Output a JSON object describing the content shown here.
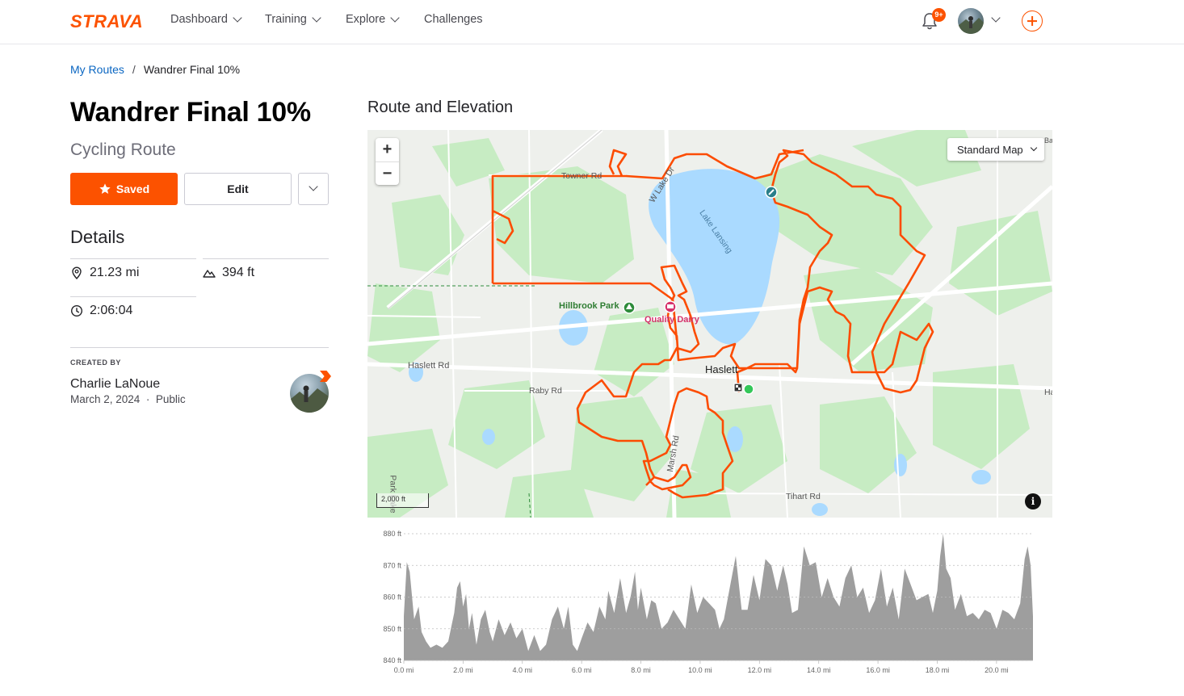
{
  "nav": {
    "logo": "STRAVA",
    "links": [
      "Dashboard",
      "Training",
      "Explore",
      "Challenges"
    ],
    "notification_badge": "9+",
    "accent": "#fc5200"
  },
  "breadcrumb": {
    "parent": "My Routes",
    "separator": "/",
    "current": "Wandrer Final 10%"
  },
  "route": {
    "title": "Wandrer Final 10%",
    "type": "Cycling Route",
    "saved_label": "Saved",
    "edit_label": "Edit"
  },
  "details": {
    "heading": "Details",
    "distance": "21.23 mi",
    "elevation": "394 ft",
    "time": "2:06:04"
  },
  "creator": {
    "label": "CREATED BY",
    "name": "Charlie LaNoue",
    "date": "March 2, 2024",
    "visibility": "Public"
  },
  "map": {
    "heading": "Route and Elevation",
    "style": "Standard Map",
    "zoom_in": "+",
    "zoom_out": "−",
    "scale": "2,000 ft",
    "info": "i",
    "labels": {
      "towner": "Towner Rd",
      "wlake": "W Lake Dr",
      "lake": "Lake Lansing",
      "hillbrook": "Hillbrook Park",
      "dairy": "Quality Dairy",
      "haslett_rd": "Haslett Rd",
      "haslett": "Haslett",
      "raby": "Raby Rd",
      "marsh": "Marsh Rd",
      "tihart": "Tihart Rd",
      "park": "Park Lake",
      "ha": "Ha",
      "ba": "Ba"
    },
    "colors": {
      "route": "#fc4c02",
      "water": "#aadaff",
      "park": "#c7ecc3"
    }
  },
  "chart_data": {
    "type": "area",
    "xlabel": "",
    "ylabel": "",
    "xlim": [
      0,
      21.23
    ],
    "ylim": [
      840,
      880
    ],
    "x_ticks": [
      "0.0 mi",
      "2.0 mi",
      "4.0 mi",
      "6.0 mi",
      "8.0 mi",
      "10.0 mi",
      "12.0 mi",
      "14.0 mi",
      "16.0 mi",
      "18.0 mi",
      "20.0 mi"
    ],
    "y_ticks": [
      "840 ft",
      "850 ft",
      "860 ft",
      "870 ft",
      "880 ft"
    ],
    "grid": true,
    "series": [
      {
        "color": "#9e9e9e",
        "x": [
          0.0,
          0.1,
          0.2,
          0.35,
          0.5,
          0.6,
          0.75,
          0.9,
          1.1,
          1.3,
          1.5,
          1.7,
          1.8,
          1.9,
          2.0,
          2.1,
          2.2,
          2.3,
          2.45,
          2.6,
          2.75,
          2.9,
          3.0,
          3.2,
          3.4,
          3.6,
          3.8,
          4.0,
          4.2,
          4.4,
          4.6,
          4.8,
          5.0,
          5.2,
          5.4,
          5.55,
          5.7,
          5.85,
          6.0,
          6.2,
          6.4,
          6.6,
          6.8,
          6.9,
          7.1,
          7.3,
          7.5,
          7.65,
          7.8,
          7.9,
          8.0,
          8.2,
          8.35,
          8.5,
          8.7,
          8.9,
          9.1,
          9.3,
          9.5,
          9.7,
          9.9,
          10.1,
          10.3,
          10.5,
          10.65,
          10.8,
          11.0,
          11.2,
          11.4,
          11.6,
          11.8,
          12.0,
          12.2,
          12.4,
          12.6,
          12.8,
          12.95,
          13.1,
          13.3,
          13.5,
          13.7,
          13.9,
          14.1,
          14.3,
          14.5,
          14.7,
          14.9,
          15.1,
          15.3,
          15.5,
          15.7,
          15.9,
          16.1,
          16.3,
          16.5,
          16.7,
          16.9,
          17.1,
          17.3,
          17.5,
          17.7,
          17.85,
          18.0,
          18.1,
          18.2,
          18.3,
          18.45,
          18.6,
          18.8,
          19.0,
          19.2,
          19.4,
          19.6,
          19.8,
          20.0,
          20.2,
          20.4,
          20.6,
          20.8,
          20.95,
          21.05,
          21.15,
          21.23
        ],
        "y": [
          854,
          871,
          868,
          853,
          857,
          849,
          846,
          844,
          845,
          844,
          846,
          855,
          863,
          865,
          857,
          861,
          850,
          855,
          845,
          853,
          856,
          849,
          846,
          853,
          848,
          852,
          847,
          850,
          843,
          848,
          843,
          845,
          853,
          857,
          850,
          857,
          845,
          843,
          847,
          852,
          849,
          857,
          853,
          862,
          855,
          866,
          855,
          860,
          868,
          856,
          863,
          853,
          859,
          858,
          850,
          852,
          856,
          853,
          850,
          864,
          855,
          860,
          858,
          856,
          850,
          853,
          863,
          873,
          856,
          856,
          867,
          859,
          872,
          870,
          862,
          870,
          864,
          855,
          856,
          876,
          870,
          871,
          860,
          866,
          860,
          857,
          866,
          870,
          860,
          863,
          855,
          859,
          869,
          857,
          863,
          853,
          869,
          864,
          859,
          860,
          861,
          855,
          862,
          873,
          880,
          869,
          866,
          856,
          861,
          854,
          855,
          853,
          856,
          855,
          850,
          856,
          855,
          853,
          858,
          872,
          876,
          870,
          854
        ]
      }
    ]
  }
}
